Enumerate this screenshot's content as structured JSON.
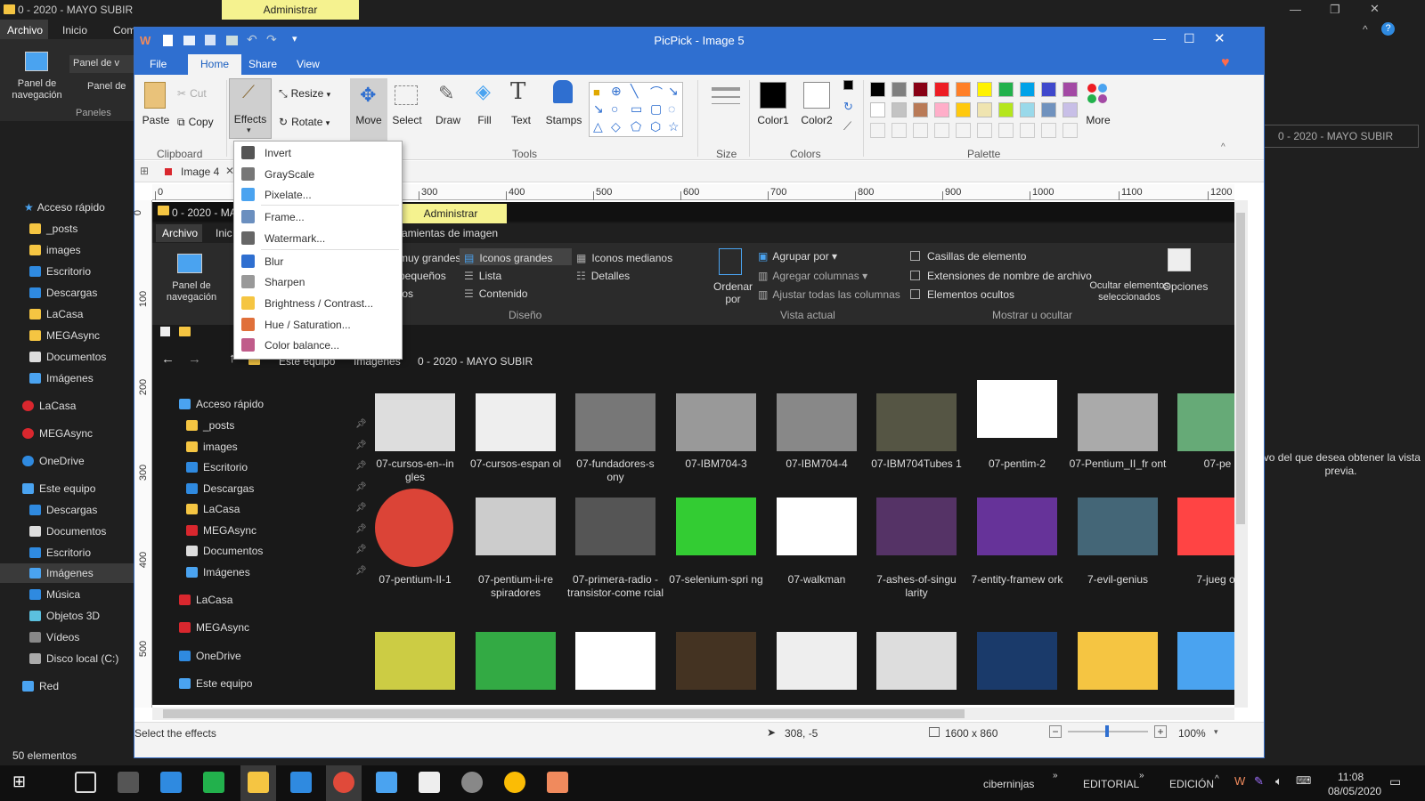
{
  "bg": {
    "title": "0 - 2020 - MAYO SUBIR",
    "admin": "Administrar",
    "tabs": [
      "Archivo",
      "Inicio",
      "Com"
    ],
    "ribbon": {
      "panel_label": "Panel de navegación",
      "group": "Paneles",
      "item1": "Panel de v",
      "item2": "Panel de"
    },
    "nav": [
      "Acceso rápido",
      "_posts",
      "images",
      "Escritorio",
      "Descargas",
      "LaCasa",
      "MEGAsync",
      "Documentos",
      "Imágenes",
      "LaCasa",
      "MEGAsync",
      "OneDrive",
      "Este equipo",
      "Descargas",
      "Documentos",
      "Escritorio",
      "Imágenes",
      "Música",
      "Objetos 3D",
      "Vídeos",
      "Disco local (C:)",
      "Red"
    ],
    "status": "50 elementos",
    "right_breadcrumb": "0 - 2020 - MAYO SUBIR",
    "preview_text": "ivo del que desea obtener la vista previa."
  },
  "taskbar": {
    "items": [
      "ciberninjas",
      "EDITORIAL",
      "EDICIÓN"
    ],
    "time": "11:08",
    "date": "08/05/2020"
  },
  "pp": {
    "title": "PicPick - Image 5",
    "tabs": [
      "File",
      "Home",
      "Share",
      "View"
    ],
    "clip": {
      "paste": "Paste",
      "cut": "Cut",
      "copy": "Copy",
      "group": "Clipboard"
    },
    "img": {
      "effects": "Effects",
      "resize": "Resize",
      "rotate": "Rotate"
    },
    "tools": {
      "move": "Move",
      "select": "Select",
      "draw": "Draw",
      "fill": "Fill",
      "text": "Text",
      "stamps": "Stamps",
      "group": "Tools"
    },
    "size": "Size",
    "colors": {
      "c1": "Color1",
      "c2": "Color2",
      "group": "Colors"
    },
    "palette": "Palette",
    "more": "More",
    "doc_tab": "Image 4",
    "status": {
      "hint": "Select the effects",
      "coords": "308, -5",
      "dims": "1600 x 860",
      "zoom": "100%"
    },
    "ruler_h": [
      "0",
      "300",
      "400",
      "500",
      "600",
      "700",
      "800",
      "900",
      "1000",
      "1100",
      "1200"
    ],
    "ruler_v": [
      "0",
      "100",
      "200",
      "300",
      "400",
      "500"
    ]
  },
  "palette": [
    "#000000",
    "#7f7f7f",
    "#880015",
    "#ed1c24",
    "#ff7f27",
    "#fff200",
    "#22b14c",
    "#00a2e8",
    "#3f48cc",
    "#a349a4",
    "#ffffff",
    "#c3c3c3",
    "#b97a57",
    "#ffaec9",
    "#ffc90e",
    "#efe4b0",
    "#b5e61d",
    "#99d9ea",
    "#7092be",
    "#c8bfe7"
  ],
  "menu": [
    "Invert",
    "GrayScale",
    "Pixelate...",
    "Frame...",
    "Watermark...",
    "Blur",
    "Sharpen",
    "Brightness / Contrast...",
    "Hue / Saturation...",
    "Color balance..."
  ],
  "inner": {
    "title": "0 - 2020 - MA",
    "admin": "Administrar",
    "tool_tab": "rramientas de imagen",
    "tabs": [
      "Archivo",
      "Inic"
    ],
    "layout": {
      "a": "muy grandes",
      "b": "Iconos grandes",
      "c": "Iconos medianos",
      "d": "pequeños",
      "e": "Lista",
      "f": "Detalles",
      "g": "tos",
      "h": "Contenido",
      "group": "Diseño"
    },
    "sort": "Ordenar por",
    "view": {
      "a": "Agrupar por",
      "b": "Agregar columnas",
      "c": "Ajustar todas las columnas",
      "group": "Vista actual"
    },
    "show": {
      "a": "Casillas de elemento",
      "b": "Extensiones de nombre de archivo",
      "c": "Elementos ocultos",
      "hide": "Ocultar elementos seleccionados",
      "opts": "Opciones",
      "group": "Mostrar u ocultar"
    },
    "panel": "Panel de navegación",
    "crumbs": [
      "Este equipo",
      "Imágenes",
      "0 - 2020 - MAYO SUBIR"
    ],
    "nav": [
      "Acceso rápido",
      "_posts",
      "images",
      "Escritorio",
      "Descargas",
      "LaCasa",
      "MEGAsync",
      "Documentos",
      "Imágenes",
      "LaCasa",
      "MEGAsync",
      "OneDrive",
      "Este equipo"
    ],
    "files": [
      "07-cursos-en--in gles",
      "07-cursos-espan ol",
      "07-fundadores-s ony",
      "07-IBM704-3",
      "07-IBM704-4",
      "07-IBM704Tubes 1",
      "07-pentim-2",
      "07-Pentium_II_fr ont",
      "07-pe",
      "07-pentium-II-1",
      "07-pentium-ii-re spiradores",
      "07-primera-radio -transistor-come rcial",
      "07-selenium-spri ng",
      "07-walkman",
      "7-ashes-of-singu larity",
      "7-entity-framew ork",
      "7-evil-genius",
      "7-jueg or"
    ]
  }
}
